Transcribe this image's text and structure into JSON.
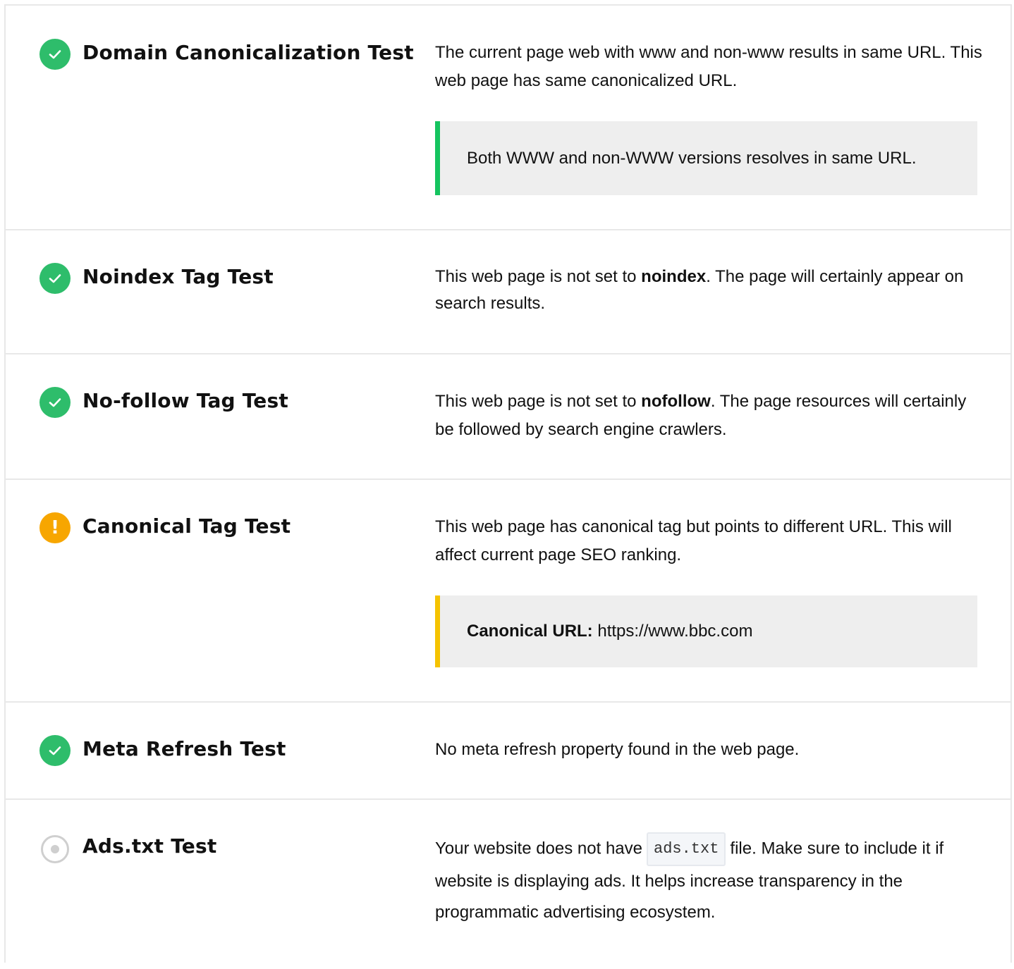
{
  "tests": [
    {
      "status": "pass",
      "status_icon": "check-circle-icon",
      "title": "Domain Canonicalization Test",
      "description": "The current page web with www and non-www results in same URL. This web page has same canonicalized URL.",
      "callout": {
        "accent": "#15c45f",
        "text": "Both WWW and non-WWW versions resolves in same URL."
      }
    },
    {
      "status": "pass",
      "status_icon": "check-circle-icon",
      "title": "Noindex Tag Test",
      "description_parts": {
        "before": "This web page is not set to ",
        "bold": "noindex",
        "after": ". The page will certainly appear on search results."
      }
    },
    {
      "status": "pass",
      "status_icon": "check-circle-icon",
      "title": "No-follow Tag Test",
      "description_parts": {
        "before": "This web page is not set to ",
        "bold": "nofollow",
        "after": ". The page resources will certainly be followed by search engine crawlers."
      }
    },
    {
      "status": "warning",
      "status_icon": "exclamation-circle-icon",
      "title": "Canonical Tag Test",
      "description": "This web page has canonical tag but points to different URL. This will affect current page SEO ranking.",
      "callout": {
        "accent": "#f5c300",
        "label": "Canonical URL:",
        "value": "https://www.bbc.com"
      }
    },
    {
      "status": "pass",
      "status_icon": "check-circle-icon",
      "title": "Meta Refresh Test",
      "description": "No meta refresh property found in the web page."
    },
    {
      "status": "info",
      "status_icon": "neutral-circle-icon",
      "title": "Ads.txt Test",
      "description_parts": {
        "before": "Your website does not have",
        "code": "ads.txt",
        "after": "file. Make sure to include it if website is displaying ads. It helps increase transparency in the programmatic advertising ecosystem."
      }
    }
  ],
  "colors": {
    "pass": "#2ebd6b",
    "warning": "#f7a600",
    "info": "#cfcfcf",
    "divider": "#e8e8e8",
    "callout_bg": "#eeeeee"
  }
}
